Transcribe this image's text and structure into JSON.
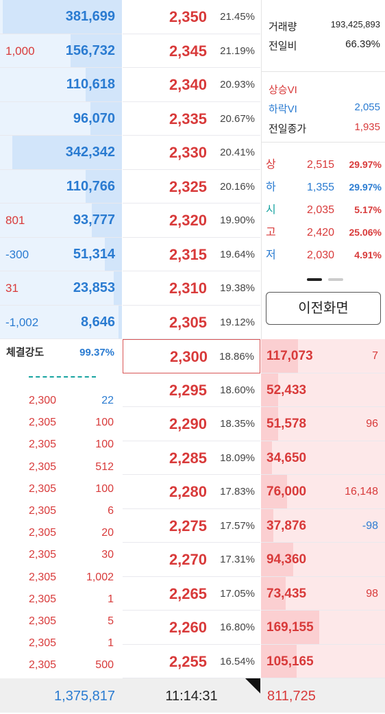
{
  "asks": [
    {
      "change": "",
      "qty": "381,699",
      "price": "2,350",
      "pct": "21.45%",
      "fill": 0.98
    },
    {
      "change": "1,000",
      "qty": "156,732",
      "price": "2,345",
      "pct": "21.19%",
      "fill": 0.42
    },
    {
      "change": "",
      "qty": "110,618",
      "price": "2,340",
      "pct": "20.93%",
      "fill": 0.3
    },
    {
      "change": "",
      "qty": "96,070",
      "price": "2,335",
      "pct": "20.67%",
      "fill": 0.26
    },
    {
      "change": "",
      "qty": "342,342",
      "price": "2,330",
      "pct": "20.41%",
      "fill": 0.9
    },
    {
      "change": "",
      "qty": "110,766",
      "price": "2,325",
      "pct": "20.16%",
      "fill": 0.3
    },
    {
      "change": "801",
      "qty": "93,777",
      "price": "2,320",
      "pct": "19.90%",
      "fill": 0.25
    },
    {
      "change": "-300",
      "qty": "51,314",
      "price": "2,315",
      "pct": "19.64%",
      "fill": 0.14
    },
    {
      "change": "31",
      "qty": "23,853",
      "price": "2,310",
      "pct": "19.38%",
      "fill": 0.07
    },
    {
      "change": "-1,002",
      "qty": "8,646",
      "price": "2,305",
      "pct": "19.12%",
      "fill": 0.03
    }
  ],
  "bids": [
    {
      "price": "2,300",
      "pct": "18.86%",
      "qty": "117,073",
      "change": "7",
      "fill": 0.3,
      "selected": true
    },
    {
      "price": "2,295",
      "pct": "18.60%",
      "qty": "52,433",
      "change": "",
      "fill": 0.14
    },
    {
      "price": "2,290",
      "pct": "18.35%",
      "qty": "51,578",
      "change": "96",
      "fill": 0.14
    },
    {
      "price": "2,285",
      "pct": "18.09%",
      "qty": "34,650",
      "change": "",
      "fill": 0.09
    },
    {
      "price": "2,280",
      "pct": "17.83%",
      "qty": "76,000",
      "change": "16,148",
      "fill": 0.21
    },
    {
      "price": "2,275",
      "pct": "17.57%",
      "qty": "37,876",
      "change": "-98",
      "fill": 0.1
    },
    {
      "price": "2,270",
      "pct": "17.31%",
      "qty": "94,360",
      "change": "",
      "fill": 0.26
    },
    {
      "price": "2,265",
      "pct": "17.05%",
      "qty": "73,435",
      "change": "98",
      "fill": 0.2
    },
    {
      "price": "2,260",
      "pct": "16.80%",
      "qty": "169,155",
      "change": "",
      "fill": 0.47
    },
    {
      "price": "2,255",
      "pct": "16.54%",
      "qty": "105,165",
      "change": "",
      "fill": 0.29
    }
  ],
  "info": {
    "volume_label": "거래량",
    "volume": "193,425,893",
    "prev_ratio_label": "전일비",
    "prev_ratio": "66.39%",
    "up_vi_label": "상승VI",
    "down_vi_label": "하락VI",
    "down_vi": "2,055",
    "prev_close_label": "전일종가",
    "prev_close": "1,935",
    "ohl": [
      {
        "label": "상",
        "price": "2,515",
        "pct": "29.97%",
        "label_color": "#d83a3a",
        "pct_color": "#d83a3a"
      },
      {
        "label": "하",
        "price": "1,355",
        "pct": "29.97%",
        "label_color": "#2a7bd1",
        "pct_color": "#2a7bd1"
      },
      {
        "label": "시",
        "price": "2,035",
        "pct": "5.17%",
        "label_color": "#17a3a0",
        "pct_color": "#d83a3a"
      },
      {
        "label": "고",
        "price": "2,420",
        "pct": "25.06%",
        "label_color": "#d83a3a",
        "pct_color": "#d83a3a"
      },
      {
        "label": "저",
        "price": "2,030",
        "pct": "4.91%",
        "label_color": "#2a7bd1",
        "pct_color": "#d83a3a"
      }
    ],
    "prev_screen_button": "이전화면"
  },
  "strength": {
    "label": "체결강도",
    "value": "99.37%",
    "trades": [
      {
        "price": "2,300",
        "vol": "22",
        "vol_color": "#2a7bd1"
      },
      {
        "price": "2,305",
        "vol": "100",
        "vol_color": "#d83a3a"
      },
      {
        "price": "2,305",
        "vol": "100",
        "vol_color": "#d83a3a"
      },
      {
        "price": "2,305",
        "vol": "512",
        "vol_color": "#d83a3a"
      },
      {
        "price": "2,305",
        "vol": "100",
        "vol_color": "#d83a3a"
      },
      {
        "price": "2,305",
        "vol": "6",
        "vol_color": "#d83a3a"
      },
      {
        "price": "2,305",
        "vol": "20",
        "vol_color": "#d83a3a"
      },
      {
        "price": "2,305",
        "vol": "30",
        "vol_color": "#d83a3a"
      },
      {
        "price": "2,305",
        "vol": "1,002",
        "vol_color": "#d83a3a"
      },
      {
        "price": "2,305",
        "vol": "1",
        "vol_color": "#d83a3a"
      },
      {
        "price": "2,305",
        "vol": "5",
        "vol_color": "#d83a3a"
      },
      {
        "price": "2,305",
        "vol": "1",
        "vol_color": "#d83a3a"
      },
      {
        "price": "2,305",
        "vol": "500",
        "vol_color": "#d83a3a"
      }
    ]
  },
  "footer": {
    "total_ask": "1,375,817",
    "time": "11:14:31",
    "total_bid": "811,725"
  }
}
